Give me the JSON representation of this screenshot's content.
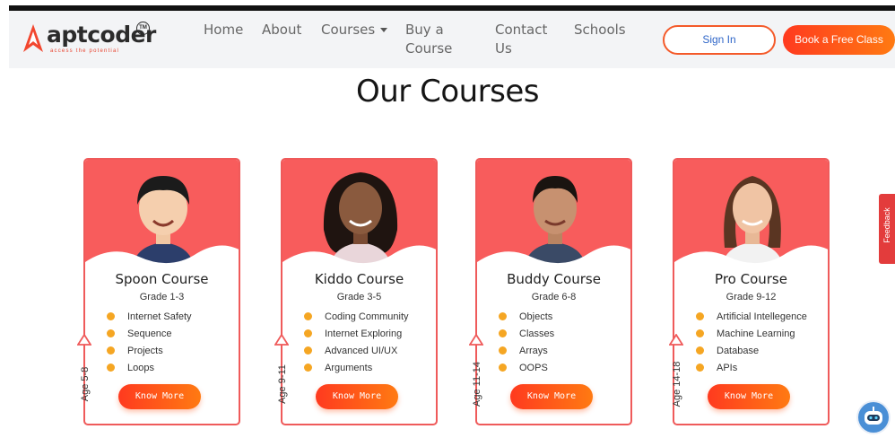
{
  "brand": {
    "name": "aptcoder",
    "tm": "TM",
    "tagline": "access the potential",
    "accent": "#f85c5c"
  },
  "nav": {
    "home": "Home",
    "about": "About",
    "courses": "Courses",
    "buy_line1": "Buy a",
    "buy_line2": "Course",
    "contact_line1": "Contact",
    "contact_line2": "Us",
    "schools": "Schools"
  },
  "header": {
    "sign_in": "Sign In",
    "book_free_class": "Book a Free Class"
  },
  "section": {
    "title": "Our Courses"
  },
  "courses": [
    {
      "title": "Spoon Course",
      "grade": "Grade 1-3",
      "age": "Age 5-8",
      "topics": [
        "Internet Safety",
        "Sequence",
        "Projects",
        "Loops"
      ],
      "cta": "Know More"
    },
    {
      "title": "Kiddo Course",
      "grade": "Grade 3-5",
      "age": "Age 9-11",
      "topics": [
        "Coding Community",
        "Internet Exploring",
        "Advanced UI/UX",
        "Arguments"
      ],
      "cta": "Know More"
    },
    {
      "title": "Buddy Course",
      "grade": "Grade 6-8",
      "age": "Age 11-14",
      "topics": [
        "Objects",
        "Classes",
        "Arrays",
        "OOPS"
      ],
      "cta": "Know More"
    },
    {
      "title": "Pro Course",
      "grade": "Grade 9-12",
      "age": "Age 14-18",
      "topics": [
        "Artificial Intellegence",
        "Machine Learning",
        "Database",
        "APIs"
      ],
      "cta": "Know More"
    }
  ],
  "widgets": {
    "feedback": "Feedback"
  }
}
